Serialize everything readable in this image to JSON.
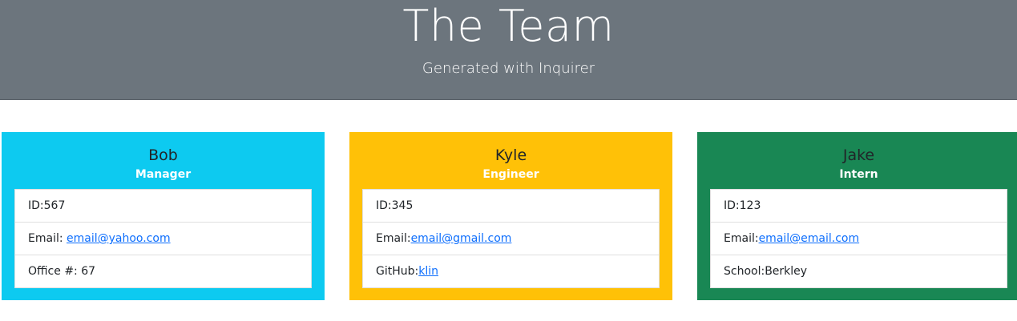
{
  "header": {
    "title": "The Team",
    "subtitle": "Generated with Inquirer"
  },
  "colors": {
    "header_bg": "#6c757d",
    "manager": "#0dcaf0",
    "engineer": "#ffc107",
    "intern": "#198754",
    "link": "#0d6efd"
  },
  "cards": [
    {
      "name": "Bob",
      "role": "Manager",
      "id_text": "ID:567",
      "email_label": "Email: ",
      "email": "email@yahoo.com",
      "extra_label": "Office #: 67",
      "extra_link": ""
    },
    {
      "name": "Kyle",
      "role": "Engineer",
      "id_text": "ID:345",
      "email_label": "Email:",
      "email": "email@gmail.com",
      "extra_label": "GitHub:",
      "extra_link": "klin"
    },
    {
      "name": "Jake",
      "role": "Intern",
      "id_text": "ID:123",
      "email_label": "Email:",
      "email": "email@email.com",
      "extra_label": "School:Berkley",
      "extra_link": ""
    }
  ]
}
